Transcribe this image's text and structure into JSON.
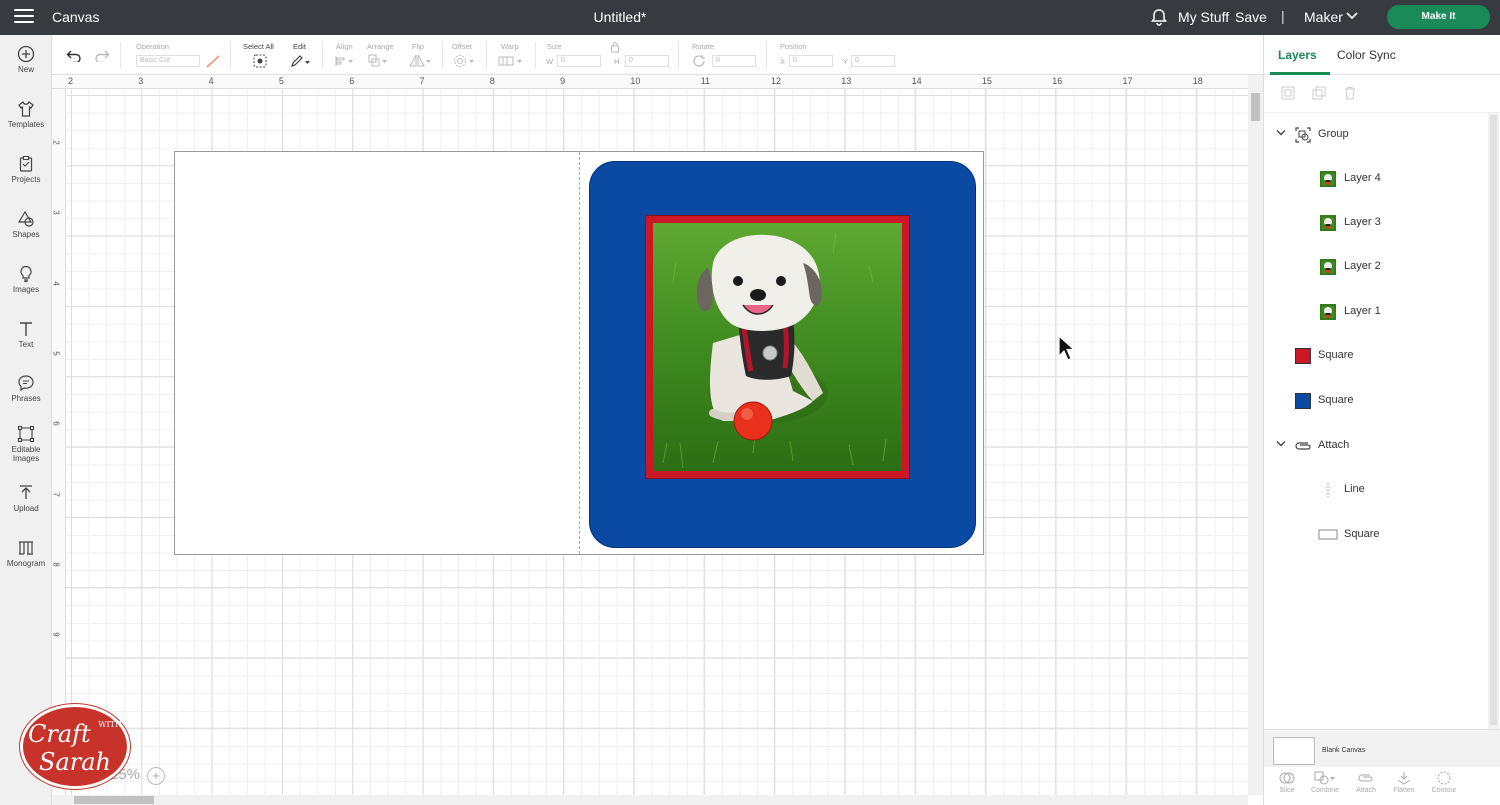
{
  "topbar": {
    "app_title": "Canvas",
    "doc_title": "Untitled*",
    "my_stuff": "My Stuff",
    "save": "Save",
    "separator": "|",
    "machine": "Maker",
    "make_it": "Make It"
  },
  "sidebar": {
    "items": [
      {
        "label": "New",
        "icon": "plus-circle-icon"
      },
      {
        "label": "Templates",
        "icon": "shirt-icon"
      },
      {
        "label": "Projects",
        "icon": "clipboard-icon"
      },
      {
        "label": "Shapes",
        "icon": "shapes-icon"
      },
      {
        "label": "Images",
        "icon": "lightbulb-icon"
      },
      {
        "label": "Text",
        "icon": "text-icon"
      },
      {
        "label": "Phrases",
        "icon": "speech-bubble-icon"
      },
      {
        "label": "Editable",
        "label2": "Images",
        "icon": "vector-edit-icon"
      },
      {
        "label": "Upload",
        "icon": "upload-icon"
      },
      {
        "label": "Monogram",
        "icon": "monogram-icon"
      }
    ]
  },
  "toolbar": {
    "operation_label": "Operation",
    "operation_value": "Basic Cut",
    "select_all": "Select All",
    "edit": "Edit",
    "align": "Align",
    "arrange": "Arrange",
    "flip": "Flip",
    "offset": "Offset",
    "warp": "Warp",
    "size": "Size",
    "w": "W",
    "w_value": "0",
    "h": "H",
    "h_value": "0",
    "rotate": "Rotate",
    "rotate_value": "0",
    "position": "Position",
    "x": "X",
    "x_value": "0",
    "y": "Y",
    "y_value": "0"
  },
  "ruler": {
    "top": [
      "2",
      "3",
      "4",
      "5",
      "6",
      "7",
      "8",
      "9",
      "10",
      "11",
      "12",
      "13",
      "14",
      "15",
      "16",
      "17",
      "18"
    ],
    "left": [
      "2",
      "3",
      "4",
      "5",
      "6",
      "7",
      "8",
      "9"
    ]
  },
  "zoom": "25%",
  "watermark": "Craft with Sarah",
  "panel": {
    "tabs": [
      "Layers",
      "Color Sync"
    ],
    "layers": [
      {
        "label": "Group",
        "type": "group",
        "level": 0
      },
      {
        "label": "Layer 4",
        "type": "photo",
        "level": 1
      },
      {
        "label": "Layer 3",
        "type": "photo",
        "level": 1
      },
      {
        "label": "Layer 2",
        "type": "photo",
        "level": 1
      },
      {
        "label": "Layer 1",
        "type": "photo",
        "level": 1
      },
      {
        "label": "Square",
        "type": "shape",
        "level": 0,
        "color": "#cc1826"
      },
      {
        "label": "Square",
        "type": "shape",
        "level": 0,
        "color": "#0a4aa2"
      },
      {
        "label": "Attach",
        "type": "attach",
        "level": 0
      },
      {
        "label": "Line",
        "type": "line",
        "level": 1
      },
      {
        "label": "Square",
        "type": "outline",
        "level": 1
      }
    ],
    "blank_canvas": "Blank Canvas",
    "bottom_tools": [
      "Slice",
      "Combine",
      "Attach",
      "Flatten",
      "Contour"
    ]
  },
  "colors": {
    "topbar_bg": "#373b3f",
    "accent_green": "#1a8a58",
    "card_blue": "#0a4aa2",
    "frame_red": "#cc1826"
  }
}
